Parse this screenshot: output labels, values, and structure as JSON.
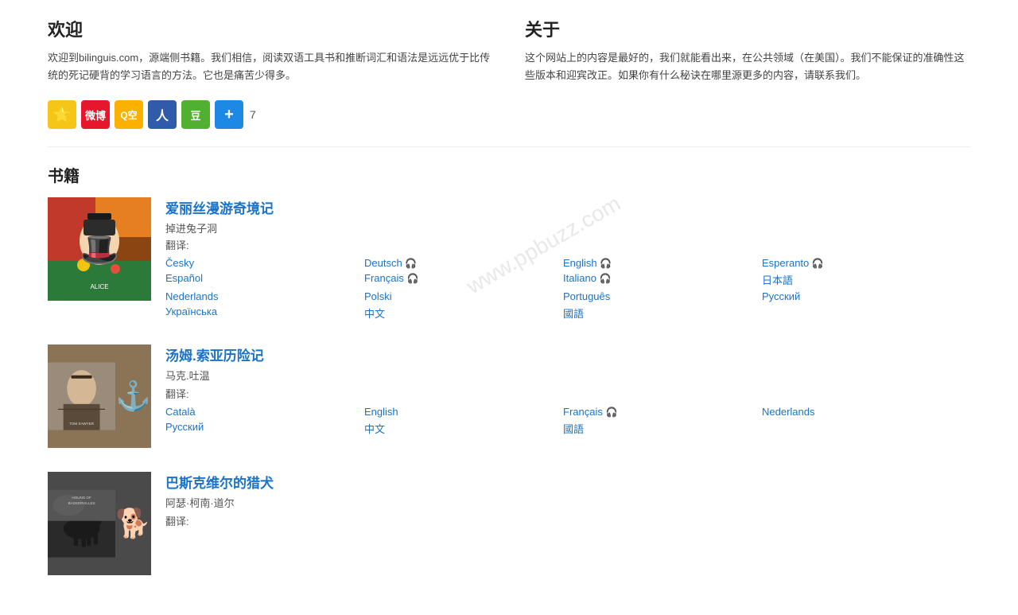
{
  "welcome": {
    "title": "欢迎",
    "text": "欢迎到bilinguis.com，源端侧书籍。我们相信，阅读双语工具书和推断词汇和语法是远远优于比传统的死记硬背的学习语言的方法。它也是痛苦少得多。"
  },
  "about": {
    "title": "关于",
    "text": "这个网站上的内容是最好的，我们就能看出来，在公共领域（在美国）。我们不能保证的准确性这些版本和迎宾改正。如果你有什么秘诀在哪里源更多的内容，请联系我们。"
  },
  "share": {
    "count": "7",
    "buttons": [
      {
        "name": "star",
        "icon": "⭐",
        "label": "收藏"
      },
      {
        "name": "weibo",
        "icon": "微",
        "label": "微博"
      },
      {
        "name": "qzone",
        "icon": "Q",
        "label": "QQ空间"
      },
      {
        "name": "renren",
        "icon": "人",
        "label": "人人网"
      },
      {
        "name": "douban",
        "icon": "豆",
        "label": "豆瓣"
      },
      {
        "name": "plus",
        "icon": "+",
        "label": "更多"
      }
    ]
  },
  "books": {
    "section_title": "书籍",
    "items": [
      {
        "id": "alice",
        "title": "爱丽丝漫游奇境记",
        "subtitle": "掉进兔子洞",
        "author_label": "翻译:",
        "languages": [
          {
            "text": "Česky",
            "has_audio": false
          },
          {
            "text": "Deutsch",
            "has_audio": true
          },
          {
            "text": "English",
            "has_audio": true
          },
          {
            "text": "Esperanto",
            "has_audio": true
          },
          {
            "text": "Español",
            "has_audio": false
          },
          {
            "text": "Français",
            "has_audio": true
          },
          {
            "text": "Italiano",
            "has_audio": true
          },
          {
            "text": "日本語",
            "has_audio": false
          },
          {
            "text": "Nederlands",
            "has_audio": false
          },
          {
            "text": "Polski",
            "has_audio": false
          },
          {
            "text": "Português",
            "has_audio": false
          },
          {
            "text": "Русский",
            "has_audio": false
          },
          {
            "text": "Українська",
            "has_audio": false
          },
          {
            "text": "中文",
            "has_audio": false
          },
          {
            "text": "國語",
            "has_audio": false
          },
          {
            "text": "",
            "has_audio": false
          }
        ]
      },
      {
        "id": "tom",
        "title": "汤姆.索亚历险记",
        "subtitle": "马克.吐温",
        "author_label": "翻译:",
        "languages": [
          {
            "text": "Català",
            "has_audio": false
          },
          {
            "text": "English",
            "has_audio": false
          },
          {
            "text": "Français",
            "has_audio": true
          },
          {
            "text": "Nederlands",
            "has_audio": false
          },
          {
            "text": "Русский",
            "has_audio": false
          },
          {
            "text": "中文",
            "has_audio": false
          },
          {
            "text": "國語",
            "has_audio": false
          },
          {
            "text": "",
            "has_audio": false
          }
        ]
      },
      {
        "id": "hound",
        "title": "巴斯克维尔的猎犬",
        "subtitle": "阿瑟·柯南·道尔",
        "author_label": "翻译:",
        "languages": []
      }
    ]
  },
  "watermark": "www.ppbuzz.com"
}
